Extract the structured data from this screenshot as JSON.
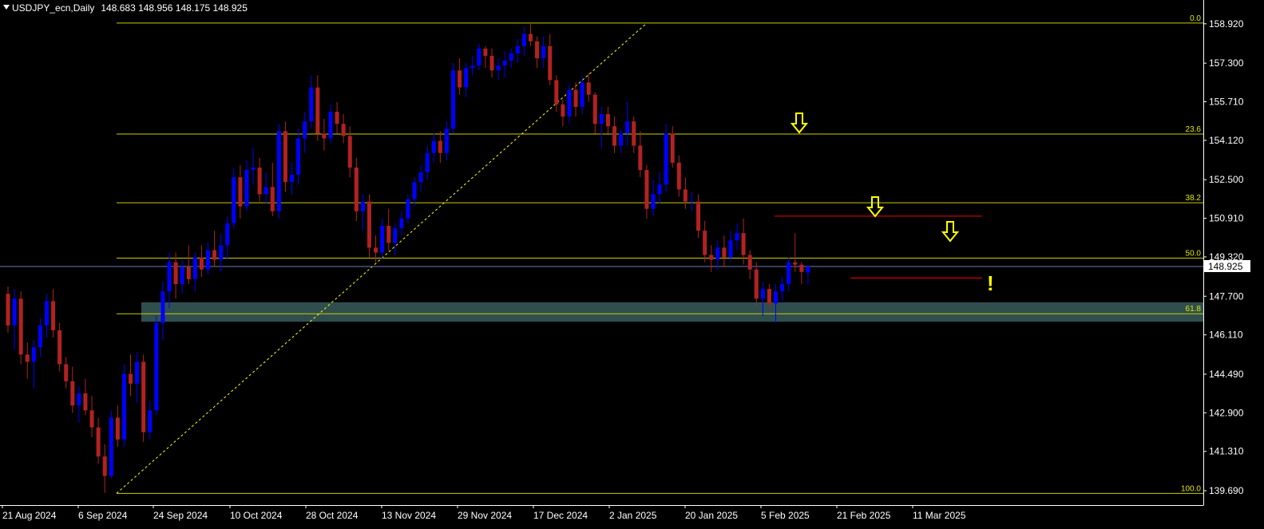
{
  "header": {
    "symbol": "USDJPY_ecn,Daily",
    "ohlc": "148.683 148.956 148.175 148.925"
  },
  "colors": {
    "background": "#000000",
    "bull_candle": "#0000ff",
    "bear_candle": "#b22222",
    "fib_line": "#cccc00",
    "fib_label": "#e6e600",
    "trend_line": "#ffff00",
    "support_zone": "#2f4f4f",
    "current_price_line": "#6e7ab8",
    "resistance_line": "#c80000",
    "arrow": "#ffff00",
    "axis_text": "#ffffff",
    "axis_line": "#ffffff"
  },
  "chart_data": {
    "type": "candlestick",
    "symbol": "USDJPY_ecn",
    "timeframe": "Daily",
    "ylim": [
      139.1,
      159.9
    ],
    "price_ticks": [
      "158.920",
      "157.300",
      "155.710",
      "154.120",
      "152.500",
      "150.910",
      "149.320",
      "147.700",
      "146.110",
      "144.490",
      "142.900",
      "141.310",
      "139.690"
    ],
    "date_labels": [
      "21 Aug 2024",
      "6 Sep 2024",
      "24 Sep 2024",
      "10 Oct 2024",
      "28 Oct 2024",
      "13 Nov 2024",
      "29 Nov 2024",
      "17 Dec 2024",
      "2 Jan 2025",
      "20 Jan 2025",
      "5 Feb 2025",
      "21 Feb 2025",
      "11 Mar 2025"
    ],
    "current_price": "148.925",
    "fibonacci": {
      "high": 158.95,
      "low": 139.58,
      "levels": [
        {
          "label": "0.0",
          "price": 158.95
        },
        {
          "label": "23.6",
          "price": 154.38
        },
        {
          "label": "38.2",
          "price": 151.55
        },
        {
          "label": "50.0",
          "price": 149.27
        },
        {
          "label": "61.8",
          "price": 146.98
        },
        {
          "label": "100.0",
          "price": 139.58
        }
      ]
    },
    "support_zone": [
      146.65,
      147.45
    ],
    "resistance_lines": [
      151.0,
      148.45
    ],
    "alert_mark": "!",
    "candles": [
      [
        147.8,
        148.1,
        146.2,
        146.5
      ],
      [
        146.5,
        148.0,
        145.5,
        147.6
      ],
      [
        147.6,
        147.9,
        144.9,
        145.3
      ],
      [
        145.3,
        145.8,
        144.3,
        145.0
      ],
      [
        145.0,
        145.9,
        143.9,
        145.6
      ],
      [
        145.6,
        146.8,
        145.2,
        146.5
      ],
      [
        146.5,
        147.8,
        146.0,
        147.5
      ],
      [
        147.5,
        148.0,
        146.0,
        146.3
      ],
      [
        146.3,
        146.6,
        144.6,
        144.9
      ],
      [
        144.9,
        145.2,
        143.9,
        144.2
      ],
      [
        144.2,
        144.8,
        142.9,
        143.2
      ],
      [
        143.2,
        144.0,
        142.5,
        143.7
      ],
      [
        143.7,
        144.3,
        142.8,
        143.0
      ],
      [
        143.0,
        143.6,
        141.9,
        142.3
      ],
      [
        142.3,
        142.7,
        140.8,
        141.1
      ],
      [
        141.1,
        141.6,
        139.6,
        140.3
      ],
      [
        140.3,
        143.0,
        140.2,
        142.7
      ],
      [
        142.7,
        143.2,
        141.5,
        141.8
      ],
      [
        141.8,
        144.9,
        141.5,
        144.5
      ],
      [
        144.5,
        145.3,
        143.6,
        144.1
      ],
      [
        144.1,
        145.4,
        143.3,
        145.0
      ],
      [
        145.0,
        145.3,
        141.7,
        142.1
      ],
      [
        142.1,
        143.4,
        141.8,
        143.0
      ],
      [
        143.0,
        146.9,
        142.8,
        146.6
      ],
      [
        146.6,
        148.3,
        145.9,
        147.9
      ],
      [
        147.9,
        149.5,
        147.2,
        149.1
      ],
      [
        149.1,
        149.5,
        147.6,
        148.2
      ],
      [
        148.2,
        149.2,
        147.8,
        148.9
      ],
      [
        148.9,
        149.8,
        148.2,
        148.4
      ],
      [
        148.4,
        149.5,
        147.9,
        149.3
      ],
      [
        149.3,
        149.8,
        148.5,
        148.8
      ],
      [
        148.8,
        149.9,
        148.6,
        149.6
      ],
      [
        149.6,
        150.4,
        148.9,
        149.2
      ],
      [
        149.2,
        150.3,
        148.7,
        149.8
      ],
      [
        149.8,
        151.0,
        149.2,
        150.7
      ],
      [
        150.7,
        153.0,
        150.5,
        152.6
      ],
      [
        152.6,
        153.1,
        150.9,
        151.4
      ],
      [
        151.4,
        153.3,
        151.2,
        152.9
      ],
      [
        152.9,
        153.8,
        152.3,
        153.0
      ],
      [
        153.0,
        153.4,
        151.6,
        151.9
      ],
      [
        151.9,
        152.8,
        151.5,
        152.2
      ],
      [
        152.2,
        153.2,
        151.0,
        151.2
      ],
      [
        151.2,
        154.8,
        150.9,
        154.5
      ],
      [
        154.5,
        154.9,
        152.0,
        152.4
      ],
      [
        152.4,
        153.2,
        151.9,
        152.7
      ],
      [
        152.7,
        154.6,
        152.3,
        154.2
      ],
      [
        154.2,
        155.3,
        153.6,
        154.9
      ],
      [
        154.9,
        156.8,
        154.6,
        156.3
      ],
      [
        156.3,
        156.8,
        154.1,
        154.4
      ],
      [
        154.4,
        155.0,
        153.7,
        154.2
      ],
      [
        154.2,
        155.6,
        154.0,
        155.3
      ],
      [
        155.3,
        155.7,
        154.4,
        154.8
      ],
      [
        154.8,
        155.2,
        154.0,
        154.3
      ],
      [
        154.3,
        154.7,
        152.6,
        153.0
      ],
      [
        153.0,
        153.4,
        150.8,
        151.2
      ],
      [
        151.2,
        151.9,
        150.4,
        151.6
      ],
      [
        151.6,
        151.9,
        149.3,
        149.7
      ],
      [
        149.7,
        150.2,
        149.1,
        149.5
      ],
      [
        149.5,
        150.9,
        149.2,
        150.6
      ],
      [
        150.6,
        151.3,
        149.6,
        149.9
      ],
      [
        149.9,
        150.7,
        149.4,
        150.5
      ],
      [
        150.5,
        151.2,
        150.2,
        150.9
      ],
      [
        150.9,
        151.9,
        150.7,
        151.7
      ],
      [
        151.7,
        152.6,
        151.4,
        152.4
      ],
      [
        152.4,
        153.1,
        152.0,
        152.8
      ],
      [
        152.8,
        153.9,
        152.5,
        153.6
      ],
      [
        153.6,
        154.4,
        153.2,
        154.1
      ],
      [
        154.1,
        154.5,
        153.2,
        153.6
      ],
      [
        153.6,
        154.9,
        153.3,
        154.6
      ],
      [
        154.6,
        157.3,
        154.4,
        157.0
      ],
      [
        157.0,
        157.5,
        156.0,
        156.3
      ],
      [
        156.3,
        157.3,
        155.9,
        157.1
      ],
      [
        157.1,
        157.6,
        156.8,
        157.2
      ],
      [
        157.2,
        158.1,
        157.0,
        157.9
      ],
      [
        157.9,
        158.0,
        157.1,
        157.6
      ],
      [
        157.6,
        157.9,
        156.7,
        157.0
      ],
      [
        157.0,
        157.5,
        156.6,
        157.2
      ],
      [
        157.2,
        157.8,
        156.7,
        157.4
      ],
      [
        157.4,
        157.9,
        157.1,
        157.7
      ],
      [
        157.7,
        158.3,
        157.3,
        158.0
      ],
      [
        158.0,
        158.8,
        157.6,
        158.5
      ],
      [
        158.5,
        158.9,
        158.0,
        158.2
      ],
      [
        158.2,
        158.4,
        157.1,
        157.5
      ],
      [
        157.5,
        158.4,
        157.1,
        158.0
      ],
      [
        158.0,
        158.5,
        156.4,
        156.6
      ],
      [
        156.6,
        156.8,
        155.3,
        155.6
      ],
      [
        155.6,
        155.8,
        154.7,
        155.1
      ],
      [
        155.1,
        156.4,
        154.8,
        156.2
      ],
      [
        156.2,
        156.5,
        155.1,
        155.5
      ],
      [
        155.5,
        156.8,
        155.2,
        156.5
      ],
      [
        156.5,
        156.9,
        155.7,
        156.0
      ],
      [
        156.0,
        156.1,
        154.4,
        154.8
      ],
      [
        154.8,
        155.5,
        153.8,
        155.2
      ],
      [
        155.2,
        155.5,
        154.4,
        154.7
      ],
      [
        154.7,
        155.1,
        153.6,
        153.9
      ],
      [
        153.9,
        154.6,
        153.6,
        154.4
      ],
      [
        154.4,
        155.7,
        153.9,
        154.9
      ],
      [
        154.9,
        155.1,
        153.6,
        153.9
      ],
      [
        153.9,
        154.5,
        152.6,
        152.9
      ],
      [
        152.9,
        153.1,
        150.9,
        151.3
      ],
      [
        151.3,
        152.5,
        151.0,
        151.9
      ],
      [
        151.9,
        152.8,
        151.5,
        152.3
      ],
      [
        152.3,
        154.8,
        152.0,
        154.4
      ],
      [
        154.4,
        154.7,
        153.0,
        153.2
      ],
      [
        153.2,
        153.5,
        151.8,
        152.1
      ],
      [
        152.1,
        152.6,
        151.3,
        151.6
      ],
      [
        151.6,
        152.0,
        151.2,
        151.6
      ],
      [
        151.6,
        151.9,
        150.1,
        150.4
      ],
      [
        150.4,
        150.8,
        149.1,
        149.4
      ],
      [
        149.4,
        149.8,
        148.7,
        149.2
      ],
      [
        149.2,
        150.0,
        148.8,
        149.7
      ],
      [
        149.7,
        150.2,
        148.9,
        149.3
      ],
      [
        149.3,
        150.4,
        149.1,
        150.0
      ],
      [
        150.0,
        150.7,
        149.6,
        150.3
      ],
      [
        150.3,
        150.9,
        149.0,
        149.4
      ],
      [
        149.4,
        149.6,
        148.4,
        148.8
      ],
      [
        148.8,
        149.1,
        147.3,
        147.6
      ],
      [
        147.6,
        148.3,
        146.9,
        148.0
      ],
      [
        148.0,
        148.2,
        147.2,
        147.4
      ],
      [
        147.4,
        148.2,
        146.6,
        147.9
      ],
      [
        147.9,
        148.5,
        147.5,
        148.2
      ],
      [
        148.2,
        149.3,
        147.9,
        149.1
      ],
      [
        149.1,
        150.3,
        148.7,
        149.0
      ],
      [
        149.0,
        149.1,
        148.2,
        148.7
      ],
      [
        148.683,
        148.956,
        148.175,
        148.925
      ]
    ]
  }
}
